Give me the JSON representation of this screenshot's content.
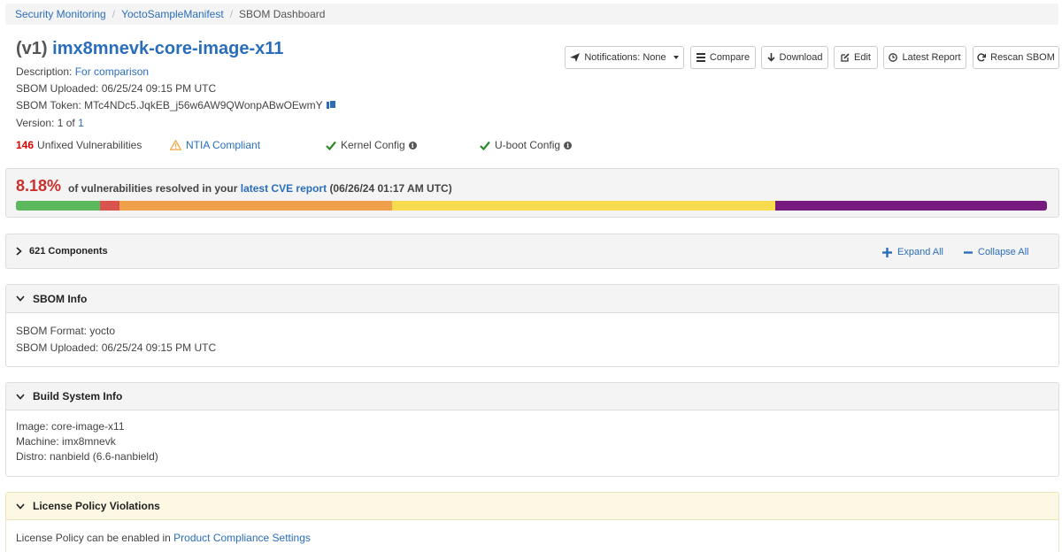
{
  "breadcrumb": {
    "items": [
      "Security Monitoring",
      "YoctoSampleManifest"
    ],
    "current": "SBOM Dashboard"
  },
  "header": {
    "version_prefix": "(v1)",
    "title": "imx8mnevk-core-image-x11",
    "description_label": "Description:",
    "description_value": "For comparison",
    "uploaded": "SBOM Uploaded: 06/25/24 09:15 PM UTC",
    "token_label": "SBOM Token:",
    "token_value": "MTc4NDc5.JqkEB_j56w6AW9QWonpABwOEwmY",
    "version_label": "Version: 1 of",
    "version_link": "1"
  },
  "toolbar": {
    "notifications_label": "Notifications: None",
    "compare_label": "Compare",
    "download_label": "Download",
    "edit_label": "Edit",
    "latest_report_label": "Latest Report",
    "rescan_label": "Rescan SBOM"
  },
  "status": {
    "unfixed_count": "146",
    "unfixed_label": "Unfixed Vulnerabilities",
    "ntia_label": "NTIA Compliant",
    "kernel_label": "Kernel Config",
    "uboot_label": "U-boot Config",
    "warn_color": "#f0ad4e",
    "check_color": "#2b8a2b"
  },
  "resolved": {
    "percent": "8.18%",
    "text_before": "of vulnerabilities resolved in your",
    "link": "latest CVE report",
    "date": "(06/26/24 01:17 AM UTC)",
    "segments": [
      {
        "fraction": 0.0818,
        "color": "#5cb85c"
      },
      {
        "fraction": 0.0185,
        "color": "#d9534f"
      },
      {
        "fraction": 0.2645,
        "color": "#f0a04b"
      },
      {
        "fraction": 0.3717,
        "color": "#f7dc4f"
      },
      {
        "fraction": 0.2635,
        "color": "#761a7e"
      }
    ]
  },
  "components": {
    "label": "621 Components",
    "expand_all": "Expand All",
    "collapse_all": "Collapse All"
  },
  "sbom_info": {
    "title": "SBOM Info",
    "format": "SBOM Format: yocto",
    "uploaded": "SBOM Uploaded: 06/25/24 09:15 PM UTC"
  },
  "build_info": {
    "title": "Build System Info",
    "image": "Image: core-image-x11",
    "machine": "Machine: imx8mnevk",
    "distro": "Distro: nanbield (6.6-nanbield)"
  },
  "license": {
    "title": "License Policy Violations",
    "text": "License Policy can be enabled in",
    "link": "Product Compliance Settings"
  }
}
